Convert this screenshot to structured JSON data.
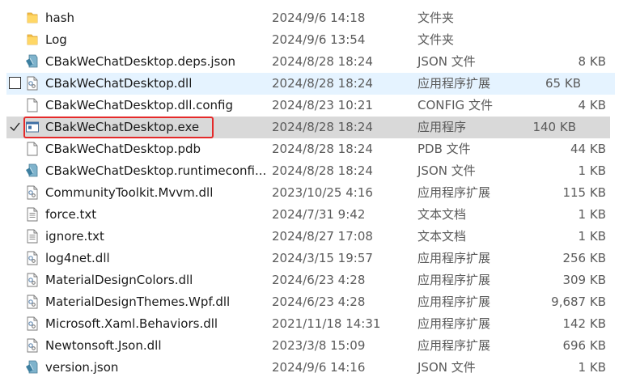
{
  "files": [
    {
      "name": "hash",
      "date": "2024/9/6 14:18",
      "type": "文件夹",
      "size": "",
      "icon": "folder-icon"
    },
    {
      "name": "Log",
      "date": "2024/9/6 13:54",
      "type": "文件夹",
      "size": "",
      "icon": "folder-icon"
    },
    {
      "name": "CBakWeChatDesktop.deps.json",
      "date": "2024/8/28 18:24",
      "type": "JSON 文件",
      "size": "8 KB",
      "icon": "json-file-icon"
    },
    {
      "name": "CBakWeChatDesktop.dll",
      "date": "2024/8/28 18:24",
      "type": "应用程序扩展",
      "size": "65 KB",
      "icon": "dll-file-icon",
      "state": "hover",
      "checked": false
    },
    {
      "name": "CBakWeChatDesktop.dll.config",
      "date": "2024/8/23 10:21",
      "type": "CONFIG 文件",
      "size": "4 KB",
      "icon": "blank-file-icon"
    },
    {
      "name": "CBakWeChatDesktop.exe",
      "date": "2024/8/28 18:24",
      "type": "应用程序",
      "size": "140 KB",
      "icon": "exe-file-icon",
      "state": "selected",
      "checked": true
    },
    {
      "name": "CBakWeChatDesktop.pdb",
      "date": "2024/8/28 18:24",
      "type": "PDB 文件",
      "size": "44 KB",
      "icon": "blank-file-icon"
    },
    {
      "name": "CBakWeChatDesktop.runtimeconfi...",
      "date": "2024/8/28 18:24",
      "type": "JSON 文件",
      "size": "1 KB",
      "icon": "json-file-icon"
    },
    {
      "name": "CommunityToolkit.Mvvm.dll",
      "date": "2023/10/25 4:16",
      "type": "应用程序扩展",
      "size": "115 KB",
      "icon": "dll-file-icon"
    },
    {
      "name": "force.txt",
      "date": "2024/7/31 9:42",
      "type": "文本文档",
      "size": "1 KB",
      "icon": "text-file-icon"
    },
    {
      "name": "ignore.txt",
      "date": "2024/8/27 17:08",
      "type": "文本文档",
      "size": "1 KB",
      "icon": "text-file-icon"
    },
    {
      "name": "log4net.dll",
      "date": "2024/3/15 19:57",
      "type": "应用程序扩展",
      "size": "256 KB",
      "icon": "dll-file-icon"
    },
    {
      "name": "MaterialDesignColors.dll",
      "date": "2024/6/23 4:28",
      "type": "应用程序扩展",
      "size": "309 KB",
      "icon": "dll-file-icon"
    },
    {
      "name": "MaterialDesignThemes.Wpf.dll",
      "date": "2024/6/23 4:28",
      "type": "应用程序扩展",
      "size": "9,687 KB",
      "icon": "dll-file-icon"
    },
    {
      "name": "Microsoft.Xaml.Behaviors.dll",
      "date": "2021/11/18 14:31",
      "type": "应用程序扩展",
      "size": "142 KB",
      "icon": "dll-file-icon"
    },
    {
      "name": "Newtonsoft.Json.dll",
      "date": "2023/3/8 15:09",
      "type": "应用程序扩展",
      "size": "696 KB",
      "icon": "dll-file-icon"
    },
    {
      "name": "version.json",
      "date": "2024/9/6 14:16",
      "type": "JSON 文件",
      "size": "1 KB",
      "icon": "json-file-icon"
    }
  ],
  "colors": {
    "hover_row": "#e5f3ff",
    "selected_row": "#d9d9d9",
    "highlight_box": "#e42a2a",
    "folder": "#f5c14b"
  }
}
